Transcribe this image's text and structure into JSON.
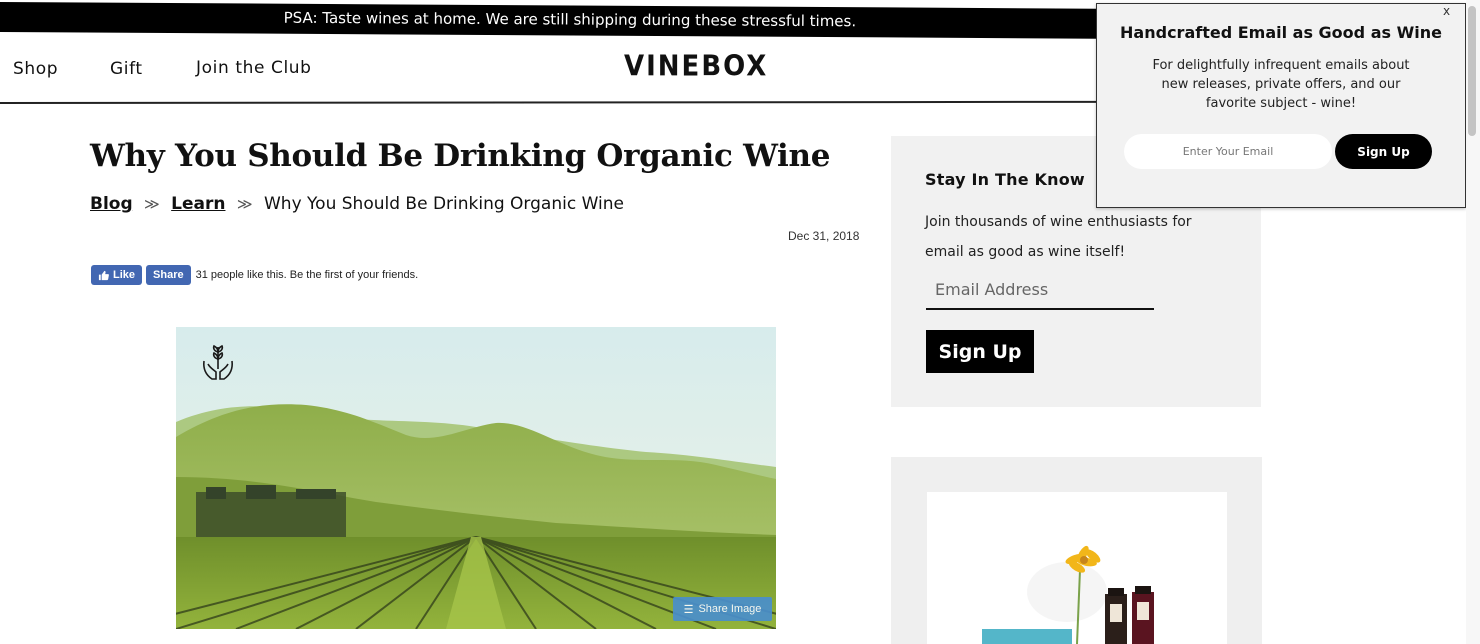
{
  "psa": {
    "text": "PSA: Taste wines at home. We are still shipping during these stressful times."
  },
  "header": {
    "nav": [
      "Shop",
      "Gift",
      "Join the Club"
    ],
    "logo": "VINEBOX"
  },
  "article": {
    "title": "Why You Should Be Drinking Organic Wine",
    "breadcrumb": {
      "items": [
        "Blog",
        "Learn"
      ],
      "current": "Why You Should Be Drinking Organic Wine",
      "separator": "≫"
    },
    "date": "Dec 31, 2018",
    "facebook": {
      "like_label": "Like",
      "share_label": "Share",
      "social_text": "31 people like this. Be the first of your friends."
    },
    "hero_image": {
      "share_label": "Share Image",
      "icon": "hands-sprout-icon"
    }
  },
  "sidebar": {
    "newsletter": {
      "title": "Stay In The Know",
      "description": "Join thousands of wine enthusiasts for email as good as wine itself!",
      "email_placeholder": "Email Address",
      "signup_label": "Sign Up"
    }
  },
  "popup": {
    "close_label": "x",
    "title": "Handcrafted Email as Good as Wine",
    "description": "For delightfully infrequent emails about new releases, private offers, and our favorite subject - wine!",
    "email_placeholder": "Enter Your Email",
    "signup_label": "Sign Up"
  },
  "colors": {
    "banner_bg": "#000000",
    "facebook_blue": "#4267b2",
    "share_image_blue": "#4a8fcc",
    "sidebar_bg": "#f1f1f1"
  }
}
